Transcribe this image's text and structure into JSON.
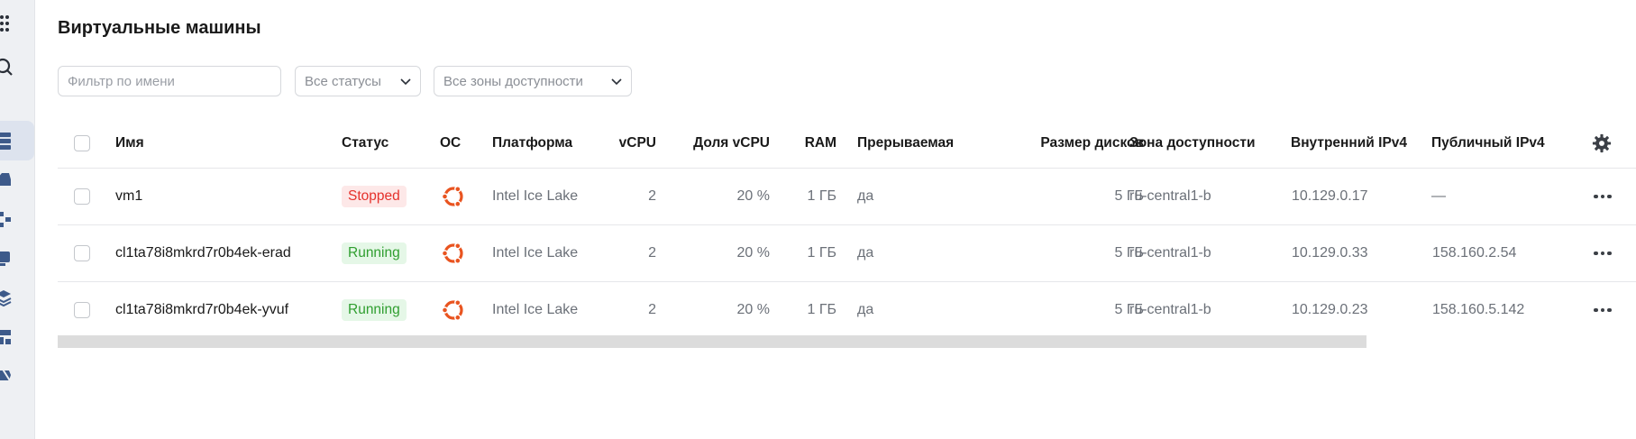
{
  "page": {
    "title": "Виртуальные машины"
  },
  "filters": {
    "name_placeholder": "Фильтр по имени",
    "status_select": "Все статусы",
    "zone_select": "Все зоны доступности"
  },
  "table": {
    "columns": {
      "name": "Имя",
      "status": "Статус",
      "os": "ОС",
      "platform": "Платформа",
      "vcpu": "vCPU",
      "vcpu_share": "Доля vCPU",
      "ram": "RAM",
      "preemptible": "Прерываемая",
      "disk_size": "Размер дисков",
      "zone": "Зона доступности",
      "internal_ipv4": "Внутренний IPv4",
      "public_ipv4": "Публичный IPv4"
    },
    "rows": [
      {
        "name": "vm1",
        "status": "Stopped",
        "os_icon": "ubuntu-icon",
        "platform": "Intel Ice Lake",
        "vcpu": "2",
        "vcpu_share": "20 %",
        "ram": "1 ГБ",
        "preemptible": "да",
        "disk_size": "5 ГБ",
        "zone": "ru-central1-b",
        "internal_ipv4": "10.129.0.17",
        "public_ipv4": "—"
      },
      {
        "name": "cl1ta78i8mkrd7r0b4ek-erad",
        "status": "Running",
        "os_icon": "ubuntu-icon",
        "platform": "Intel Ice Lake",
        "vcpu": "2",
        "vcpu_share": "20 %",
        "ram": "1 ГБ",
        "preemptible": "да",
        "disk_size": "5 ГБ",
        "zone": "ru-central1-b",
        "internal_ipv4": "10.129.0.33",
        "public_ipv4": "158.160.2.54"
      },
      {
        "name": "cl1ta78i8mkrd7r0b4ek-yvuf",
        "status": "Running",
        "os_icon": "ubuntu-icon",
        "platform": "Intel Ice Lake",
        "vcpu": "2",
        "vcpu_share": "20 %",
        "ram": "1 ГБ",
        "preemptible": "да",
        "disk_size": "5 ГБ",
        "zone": "ru-central1-b",
        "internal_ipv4": "10.129.0.23",
        "public_ipv4": "158.160.5.142"
      }
    ]
  },
  "colors": {
    "stopped": "#e5312b",
    "running": "#2f9e2f",
    "ubuntu": "#e95420"
  }
}
